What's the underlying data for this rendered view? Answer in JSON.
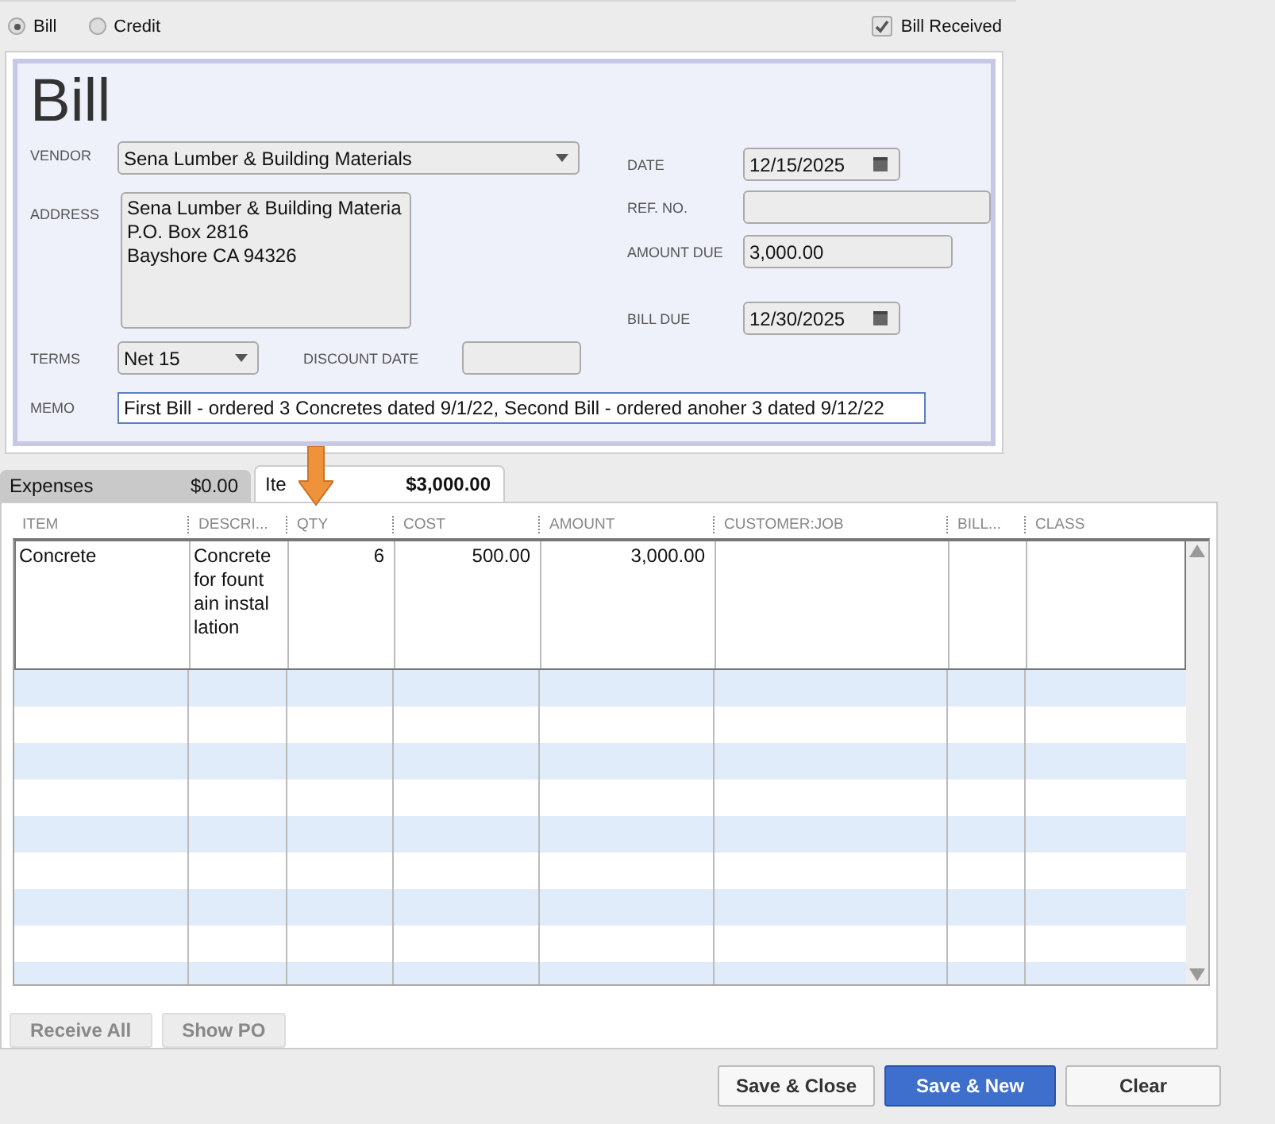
{
  "type_options": [
    {
      "label": "Bill",
      "selected": true
    },
    {
      "label": "Credit",
      "selected": false
    }
  ],
  "bill_received": {
    "label": "Bill Received",
    "checked": true
  },
  "form": {
    "title": "Bill",
    "vendor": {
      "label": "VENDOR",
      "value": "Sena Lumber & Building Materials"
    },
    "address": {
      "label": "ADDRESS",
      "lines": [
        "Sena Lumber & Building Materia",
        "P.O. Box 2816",
        "Bayshore CA 94326"
      ]
    },
    "terms": {
      "label": "TERMS",
      "value": "Net 15"
    },
    "discount_date": {
      "label": "DISCOUNT DATE"
    },
    "memo": {
      "label": "MEMO",
      "value": "First Bill - ordered 3 Concretes dated 9/1/22, Second Bill - ordered anoher 3 dated 9/12/22"
    },
    "date": {
      "label": "DATE",
      "value": "12/15/2025"
    },
    "ref_no": {
      "label": "REF. NO."
    },
    "amount_due": {
      "label": "AMOUNT DUE",
      "value": "3,000.00"
    },
    "bill_due": {
      "label": "BILL DUE",
      "value": "12/30/2025"
    }
  },
  "tabs": [
    {
      "label": "Expenses",
      "amount": "$0.00",
      "selected": false
    },
    {
      "label": "Ite",
      "amount": "$3,000.00",
      "selected": true
    }
  ],
  "table": {
    "columns": [
      "ITEM",
      "DESCRI...",
      "QTY",
      "COST",
      "AMOUNT",
      "CUSTOMER:JOB",
      "BILL...",
      "CLASS"
    ],
    "rows": [
      {
        "item": "Concrete",
        "description": "Concrete for fountain installation",
        "qty": "6",
        "cost": "500.00",
        "amount": "3,000.00"
      }
    ]
  },
  "secondary_buttons": [
    {
      "label": "Receive All",
      "disabled": true
    },
    {
      "label": "Show PO",
      "disabled": true
    }
  ],
  "buttons": [
    {
      "label": "Save & Close",
      "primary": false
    },
    {
      "label": "Save & New",
      "primary": true
    },
    {
      "label": "Clear",
      "primary": false
    }
  ]
}
